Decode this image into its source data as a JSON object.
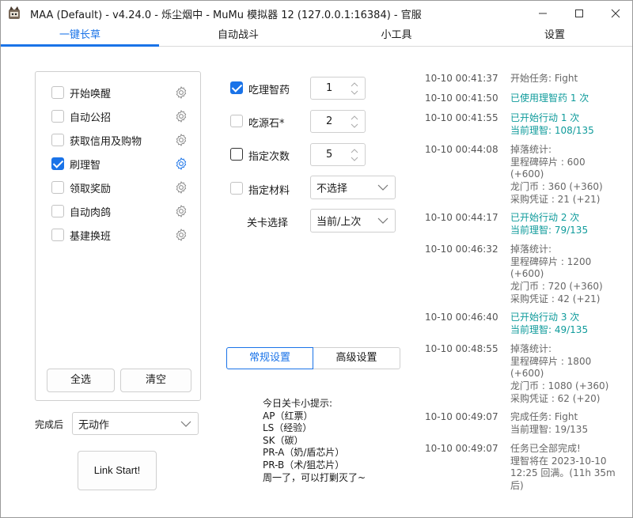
{
  "window": {
    "title": "MAA (Default) - v4.24.0 - 烁尘烟中 - MuMu 模拟器 12 (127.0.0.1:16384) - 官服"
  },
  "tabs": [
    {
      "label": "一键长草",
      "active": true
    },
    {
      "label": "自动战斗",
      "active": false
    },
    {
      "label": "小工具",
      "active": false
    },
    {
      "label": "设置",
      "active": false
    }
  ],
  "tasks": [
    {
      "label": "开始唤醒",
      "checked": false
    },
    {
      "label": "自动公招",
      "checked": false
    },
    {
      "label": "获取信用及购物",
      "checked": false
    },
    {
      "label": "刷理智",
      "checked": true
    },
    {
      "label": "领取奖励",
      "checked": false
    },
    {
      "label": "自动肉鸽",
      "checked": false
    },
    {
      "label": "基建换班",
      "checked": false
    }
  ],
  "task_buttons": {
    "select_all": "全选",
    "clear": "清空"
  },
  "after_finish": {
    "label": "完成后",
    "value": "无动作"
  },
  "start_button": "Link Start!",
  "fight_settings": {
    "use_medicine": {
      "label": "吃理智药",
      "checked": true,
      "value": "1"
    },
    "use_stone": {
      "label": "吃源石*",
      "checked": false,
      "value": "2"
    },
    "times": {
      "label": "指定次数",
      "checked": false,
      "value": "5"
    },
    "material": {
      "label": "指定材料",
      "checked": false,
      "value": "不选择"
    },
    "stage": {
      "label": "关卡选择",
      "value": "当前/上次"
    }
  },
  "settings_tabs": {
    "normal": "常规设置",
    "advanced": "高级设置"
  },
  "tips": [
    "今日关卡小提示:",
    "AP（红票）",
    "LS（经验）",
    "SK（碳）",
    "PR-A（奶/盾芯片）",
    "PR-B（术/狙芯片）",
    "周一了，可以打剿灭了~"
  ],
  "log": [
    {
      "time": "10-10  00:41:37",
      "lines": [
        {
          "text": "开始任务: Fight",
          "color": "gray"
        }
      ]
    },
    {
      "time": "10-10  00:41:50",
      "lines": [
        {
          "text": "已使用理智药 1 次",
          "color": "teal"
        }
      ]
    },
    {
      "time": "10-10  00:41:55",
      "lines": [
        {
          "text": "已开始行动 1 次",
          "color": "teal"
        },
        {
          "text": "当前理智: 108/135",
          "color": "teal"
        }
      ]
    },
    {
      "time": "10-10  00:44:08",
      "lines": [
        {
          "text": "掉落统计:",
          "color": "gray"
        },
        {
          "text": "里程碑碎片 : 600",
          "color": "gray"
        },
        {
          "text": "(+600)",
          "color": "gray"
        },
        {
          "text": "龙门币 : 360 (+360)",
          "color": "gray"
        },
        {
          "text": "采购凭证 : 21 (+21)",
          "color": "gray"
        }
      ]
    },
    {
      "time": "10-10  00:44:17",
      "lines": [
        {
          "text": "已开始行动 2 次",
          "color": "teal"
        },
        {
          "text": "当前理智: 79/135",
          "color": "teal"
        }
      ]
    },
    {
      "time": "10-10  00:46:32",
      "lines": [
        {
          "text": "掉落统计:",
          "color": "gray"
        },
        {
          "text": "里程碑碎片 : 1200",
          "color": "gray"
        },
        {
          "text": "(+600)",
          "color": "gray"
        },
        {
          "text": "龙门币 : 720 (+360)",
          "color": "gray"
        },
        {
          "text": "采购凭证 : 42 (+21)",
          "color": "gray"
        }
      ]
    },
    {
      "time": "10-10  00:46:40",
      "lines": [
        {
          "text": "已开始行动 3 次",
          "color": "teal"
        },
        {
          "text": "当前理智: 49/135",
          "color": "teal"
        }
      ]
    },
    {
      "time": "10-10  00:48:55",
      "lines": [
        {
          "text": "掉落统计:",
          "color": "gray"
        },
        {
          "text": "里程碑碎片 : 1800",
          "color": "gray"
        },
        {
          "text": "(+600)",
          "color": "gray"
        },
        {
          "text": "龙门币 : 1080 (+360)",
          "color": "gray"
        },
        {
          "text": "采购凭证 : 62 (+20)",
          "color": "gray"
        }
      ]
    },
    {
      "time": "10-10  00:49:07",
      "lines": [
        {
          "text": "完成任务: Fight",
          "color": "gray"
        },
        {
          "text": "当前理智: 19/135",
          "color": "gray"
        }
      ]
    },
    {
      "time": "10-10  00:49:07",
      "lines": [
        {
          "text": "任务已全部完成!",
          "color": "gray"
        },
        {
          "text": "理智将在 2023-10-10",
          "color": "gray"
        },
        {
          "text": "12:25 回满。(11h 35m",
          "color": "gray"
        },
        {
          "text": "后)",
          "color": "gray"
        }
      ]
    }
  ],
  "colors": {
    "accent": "#1a73e8",
    "log_teal": "#0f9b9b",
    "log_gray": "#666666"
  },
  "icons": {
    "app": "maa-app-icon",
    "gear": "gear-icon",
    "minimize": "minimize-icon",
    "maximize": "maximize-icon",
    "close": "close-icon"
  }
}
